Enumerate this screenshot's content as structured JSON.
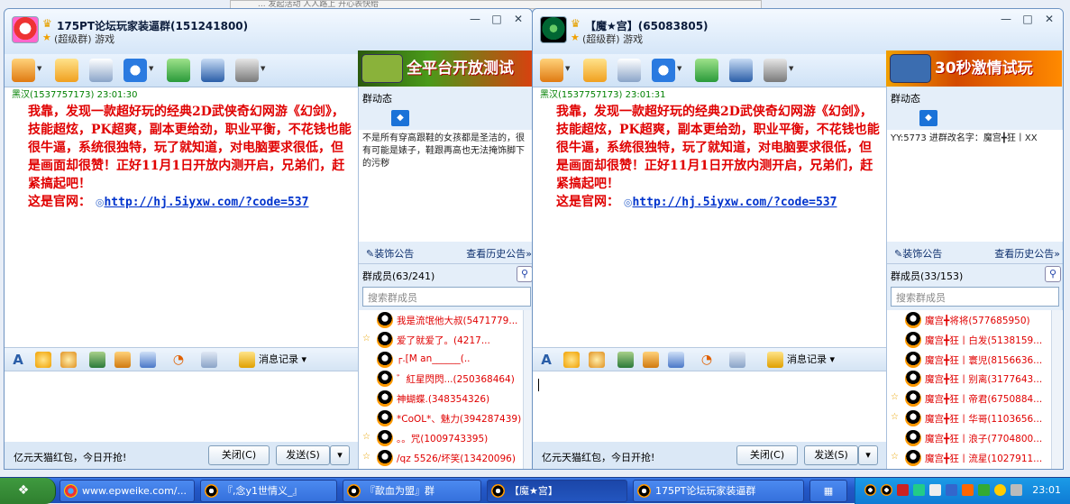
{
  "background_window": {
    "text": "... 发起活动 人人路上 开心表快给"
  },
  "windows": [
    {
      "group_name": "175PT论坛玩家装逼群(151241800)",
      "group_type": "(超级群) 游戏",
      "banner_text": "全平台开放测试",
      "chat": {
        "sender": "黑汉(1537757173)  23:01:30",
        "message": "我靠，发现一款超好玩的经典2D武侠奇幻网游《幻剑》，技能超炫，PK超爽，副本更给劲，职业平衡，不花钱也能很牛逼，系统很独特，玩了就知道，对电脑要求很低，但是画面却很赞！正好11月1日开放内测开启，兄弟们，赶紧搞起吧！",
        "url_prefix": "这是官网：",
        "url": "http://hj.5iyxw.com/?code=537"
      },
      "message_log_label": "消息记录",
      "ad_text": "亿元天猫红包，今日开抢!",
      "close_button": "关闭(C)",
      "send_button": "发送(S)",
      "group_news_label": "群动态",
      "notice_text": "不是所有穿高跟鞋的女孩都是圣洁的，很有可能是婊子，鞋跟再高也无法掩饰脚下的污秽",
      "decorate_label": "装饰公告",
      "history_label": "查看历史公告",
      "members_header": "群成员(63/241)",
      "member_search_placeholder": "搜索群成员",
      "members": [
        {
          "name": "我是流氓他大叔(5471779...",
          "badge": ""
        },
        {
          "name": "爱了就爱了。(4217...",
          "badge": "☆"
        },
        {
          "name": "┌.[M an______(..",
          "badge": ""
        },
        {
          "name": "゛紅星閃閃...(250368464)",
          "badge": ""
        },
        {
          "name": "神蝴蝶.(348354326)",
          "badge": ""
        },
        {
          "name": "*CoOL*、魅力(394287439)",
          "badge": ""
        },
        {
          "name": "。。咒(1009743395)",
          "badge": "☆"
        },
        {
          "name": "/qz 5526/坏笑(13420096)",
          "badge": "☆"
        }
      ]
    },
    {
      "group_name": "【魔★宫】(65083805)",
      "group_type": "(超级群) 游戏",
      "banner_text": "30秒激情试玩",
      "chat": {
        "sender": "黑汉(1537757173)  23:01:31",
        "message": "我靠，发现一款超好玩的经典2D武侠奇幻网游《幻剑》，技能超炫，PK超爽，副本更给劲，职业平衡，不花钱也能很牛逼，系统很独特，玩了就知道，对电脑要求很低，但是画面却很赞！正好11月1日开放内测开启，兄弟们，赶紧搞起吧！",
        "url_prefix": "这是官网：",
        "url": "http://hj.5iyxw.com/?code=537"
      },
      "message_log_label": "消息记录",
      "ad_text": "亿元天猫红包，今日开抢!",
      "close_button": "关闭(C)",
      "send_button": "发送(S)",
      "group_news_label": "群动态",
      "notice_text": "YY:5773 进群改名字：魔宫╋狂丨XX",
      "decorate_label": "装饰公告",
      "history_label": "查看历史公告",
      "members_header": "群成员(33/153)",
      "member_search_placeholder": "搜索群成员",
      "members": [
        {
          "name": "魔宫╋将将(577685950)",
          "badge": ""
        },
        {
          "name": "魔宫╋狂丨白发(5138159...",
          "badge": ""
        },
        {
          "name": "魔宫╋狂丨寰児(8156636...",
          "badge": ""
        },
        {
          "name": "魔宫╋狂丨别离(3177643...",
          "badge": ""
        },
        {
          "name": "魔宫╋狂丨帝君(6750884...",
          "badge": "☆"
        },
        {
          "name": "魔宫╋狂丨华哥(1103656...",
          "badge": "☆"
        },
        {
          "name": "魔宫╋狂丨浪子(7704800...",
          "badge": ""
        },
        {
          "name": "魔宫╋狂丨流星(1027911...",
          "badge": "☆"
        }
      ]
    }
  ],
  "taskbar": {
    "buttons": [
      {
        "label": "www.epweike.com/..."
      },
      {
        "label": "『,念y1世情义_』"
      },
      {
        "label": "『歃血为盟』群"
      },
      {
        "label": "【魔★宫】"
      },
      {
        "label": "175PT论坛玩家装逼群"
      }
    ],
    "clock": "23:01"
  }
}
